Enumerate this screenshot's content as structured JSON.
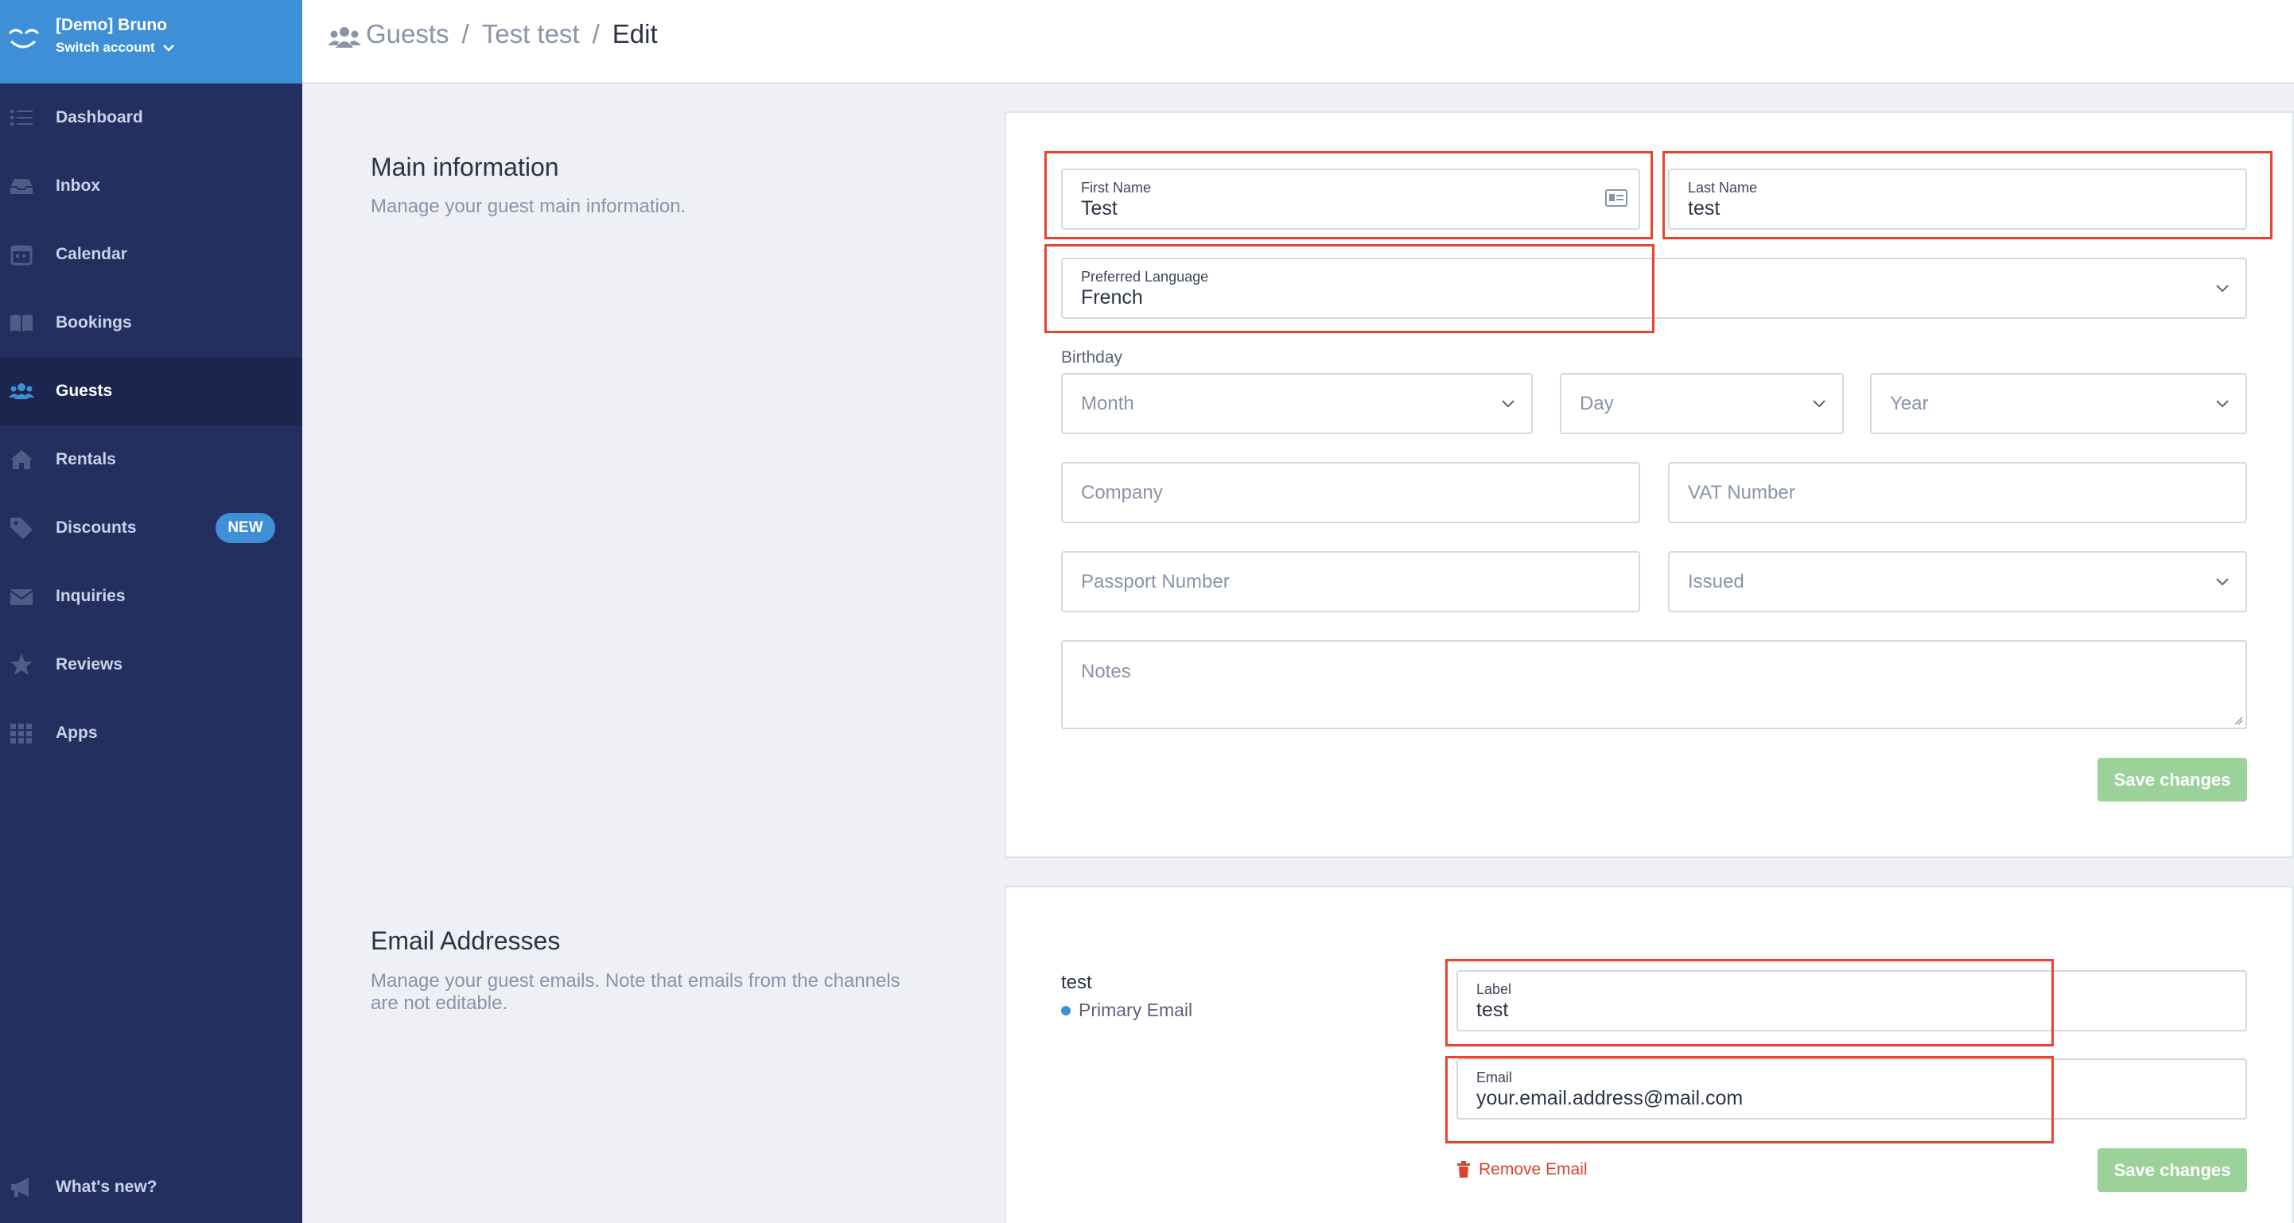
{
  "account": {
    "name": "[Demo] Bruno",
    "switch_label": "Switch account"
  },
  "nav": [
    {
      "label": "Dashboard",
      "icon": "list-icon"
    },
    {
      "label": "Inbox",
      "icon": "inbox-icon"
    },
    {
      "label": "Calendar",
      "icon": "calendar-icon"
    },
    {
      "label": "Bookings",
      "icon": "book-icon"
    },
    {
      "label": "Guests",
      "icon": "users-icon",
      "active": true
    },
    {
      "label": "Rentals",
      "icon": "home-icon"
    },
    {
      "label": "Discounts",
      "icon": "tag-icon",
      "badge": "NEW"
    },
    {
      "label": "Inquiries",
      "icon": "envelope-icon"
    },
    {
      "label": "Reviews",
      "icon": "star-icon"
    },
    {
      "label": "Apps",
      "icon": "grid-icon"
    }
  ],
  "whats_new": {
    "label": "What's new?",
    "icon": "megaphone-icon"
  },
  "breadcrumb": {
    "items": [
      "Guests",
      "Test test",
      "Edit"
    ],
    "separator": "/"
  },
  "main_info": {
    "title": "Main information",
    "description": "Manage your guest main information.",
    "first_name": {
      "label": "First Name",
      "value": "Test"
    },
    "last_name": {
      "label": "Last Name",
      "value": "test"
    },
    "language": {
      "label": "Preferred Language",
      "value": "French"
    },
    "birthday_label": "Birthday",
    "month_placeholder": "Month",
    "day_placeholder": "Day",
    "year_placeholder": "Year",
    "company_placeholder": "Company",
    "vat_placeholder": "VAT Number",
    "passport_placeholder": "Passport Number",
    "issued_placeholder": "Issued",
    "notes_placeholder": "Notes",
    "save_label": "Save changes"
  },
  "emails": {
    "title": "Email Addresses",
    "description_line1": "Manage your guest emails. Note that emails from the channels",
    "description_line2": "are not editable.",
    "entry_name": "test",
    "primary_label": "Primary Email",
    "label_field": {
      "label": "Label",
      "value": "test"
    },
    "email_field": {
      "label": "Email",
      "value": "your.email.address@mail.com"
    },
    "remove_label": "Remove Email",
    "save_label": "Save changes"
  },
  "colors": {
    "sidebar": "#232f5f",
    "account": "#3e8fd6",
    "highlight": "#e6452f",
    "save": "#9bd29a",
    "remove": "#d9432f"
  }
}
